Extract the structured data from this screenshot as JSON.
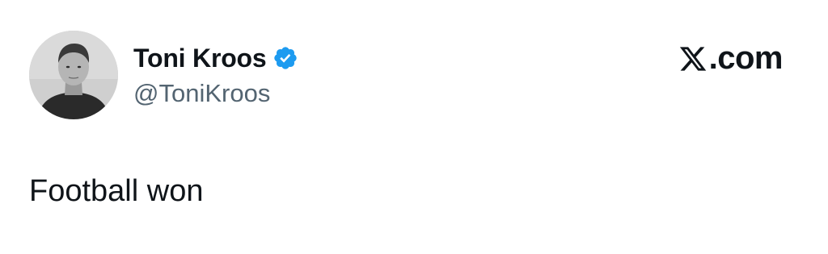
{
  "post": {
    "author": {
      "display_name": "Toni Kroos",
      "handle": "@ToniKroos",
      "verified": true,
      "verified_color": "#1d9bf0",
      "avatar_icon": "profile-photo"
    },
    "brand": {
      "domain_suffix": ".com",
      "logo_icon": "x-logo-icon"
    },
    "text": "Football won"
  },
  "colors": {
    "text_primary": "#0f1419",
    "text_secondary": "#536471",
    "background": "#ffffff"
  }
}
